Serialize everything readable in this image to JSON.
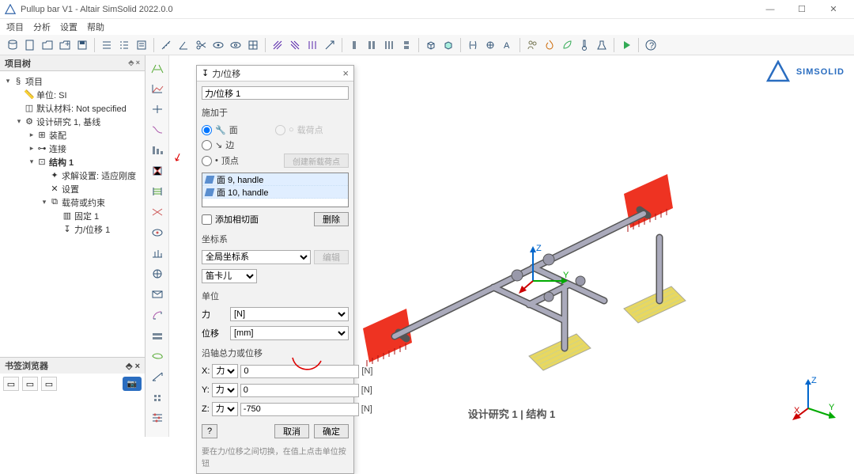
{
  "window": {
    "title": "Pullup bar V1 - Altair SimSolid 2022.0.0"
  },
  "menu": {
    "project": "项目",
    "analysis": "分析",
    "settings": "设置",
    "help": "帮助"
  },
  "panels": {
    "project_tree": {
      "title": "项目树",
      "pin_hint": "⬘ ×"
    },
    "bookmark": {
      "title": "书签浏览器",
      "pin_hint": "⬘ ×"
    }
  },
  "tree": {
    "root": "项目",
    "unit": "单位: SI",
    "material": "默认材料: Not specified",
    "study": "设计研究 1, 基线",
    "assembly": "装配",
    "connection": "连接",
    "structure": "结构 1",
    "solve": "求解设置: 适应刚度",
    "setup": "设置",
    "loads": "载荷或约束",
    "fixed": "固定 1",
    "forcedisp": "力/位移 1"
  },
  "dialog": {
    "title": "力/位移",
    "name_value": "力/位移 1",
    "apply_to_label": "施加于",
    "radio_face": "面",
    "radio_edge": "边",
    "radio_vertex": "顶点",
    "radio_loadpoint": "载荷点",
    "btn_create_loadpoint": "创建新载荷点",
    "selections": [
      "面 9, handle",
      "面 10, handle"
    ],
    "chk_tangent": "添加相切面",
    "btn_delete": "删除",
    "coord_label": "坐标系",
    "coord_global": "全局坐标系",
    "coord_cartesian": "笛卡儿",
    "btn_edit": "编辑",
    "units_label": "单位",
    "force_label": "力",
    "force_unit": "[N]",
    "disp_label": "位移",
    "disp_unit": "[mm]",
    "axis_group": "沿轴总力或位移",
    "x_label": "X:",
    "y_label": "Y:",
    "z_label": "Z:",
    "mode_force": "力",
    "x_value": "0",
    "y_value": "0",
    "z_value": "-750",
    "axis_unit": "[N]",
    "btn_cancel": "取消",
    "btn_ok": "确定",
    "help": "?",
    "hint": "要在力/位移之间切换，在值上点击单位按钮"
  },
  "canvas": {
    "logo": "SIMSOLID",
    "view_label": "设计研究 1 | 结构 1",
    "z": "Z",
    "y": "Y",
    "x": "X"
  }
}
